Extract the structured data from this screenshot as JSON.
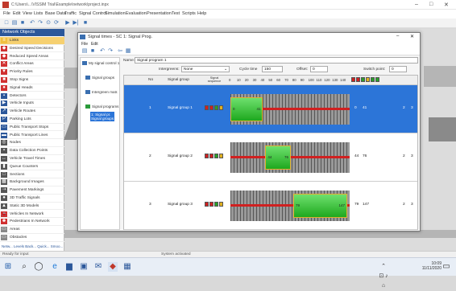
{
  "app": {
    "title": "C:\\Users\\...\\VISSIM Trial\\Example\\network\\project.inpx",
    "window_controls": [
      "–",
      "□",
      "✕"
    ]
  },
  "menu": [
    "File",
    "Edit",
    "View",
    "Lists",
    "Base Data",
    "Traffic",
    "Signal Control",
    "Simulation",
    "Evaluation",
    "Presentation",
    "Test",
    "Scripts",
    "Help"
  ],
  "network_objects": {
    "title": "Network Objects",
    "items": [
      {
        "label": "Links",
        "icon": "≡",
        "color": "#f0c040",
        "selected": true
      },
      {
        "label": "Desired Speed Decisions",
        "icon": "◆",
        "color": "#d03030"
      },
      {
        "label": "Reduced Speed Areas",
        "icon": "◆",
        "color": "#d03030"
      },
      {
        "label": "Conflict Areas",
        "icon": "✕",
        "color": "#d03030"
      },
      {
        "label": "Priority Rules",
        "icon": "▼",
        "color": "#d03030"
      },
      {
        "label": "Stop Signs",
        "icon": "■",
        "color": "#d03030"
      },
      {
        "label": "Signal Heads",
        "icon": "●",
        "color": "#d03030"
      },
      {
        "label": "Detectors",
        "icon": "▪",
        "color": "#2b579a"
      },
      {
        "label": "Vehicle Inputs",
        "icon": "▶",
        "color": "#2b579a"
      },
      {
        "label": "Vehicle Routes",
        "icon": "↗",
        "color": "#2b579a"
      },
      {
        "label": "Parking Lots",
        "icon": "P",
        "color": "#2b579a"
      },
      {
        "label": "Public Transport Stops",
        "icon": "▭",
        "color": "#2b579a"
      },
      {
        "label": "Public Transport Lines",
        "icon": "▬",
        "color": "#2b579a"
      },
      {
        "label": "Nodes",
        "icon": "◎",
        "color": "#555555"
      },
      {
        "label": "Data Collection Points",
        "icon": "▪",
        "color": "#555555"
      },
      {
        "label": "Vehicle Travel Times",
        "icon": "↔",
        "color": "#555555"
      },
      {
        "label": "Queue Counters",
        "icon": "▮",
        "color": "#555555"
      },
      {
        "label": "Sections",
        "icon": "□",
        "color": "#555555"
      },
      {
        "label": "Background Images",
        "icon": "▦",
        "color": "#555555"
      },
      {
        "label": "Pavement Markings",
        "icon": "⇢",
        "color": "#555555"
      },
      {
        "label": "3D Traffic Signals",
        "icon": "●",
        "color": "#555555"
      },
      {
        "label": "Static 3D Models",
        "icon": "▲",
        "color": "#555555"
      },
      {
        "label": "Vehicles In Network",
        "icon": "🚗",
        "color": "#d03030"
      },
      {
        "label": "Pedestrians In Network",
        "icon": "☻",
        "color": "#d03030"
      },
      {
        "label": "Areas",
        "icon": "▭",
        "color": "#888888"
      },
      {
        "label": "Obstacles",
        "icon": "▭",
        "color": "#888888"
      }
    ],
    "tabs": "Netw...  Levels  Back...  Quick...  Smoo..."
  },
  "dialog": {
    "title": "Signal times - SC 1: Signal Prog.",
    "menu": [
      "File",
      "Edit"
    ],
    "tree": {
      "root": "My signal control 1",
      "signal_groups": "Signal groups",
      "intergreen": "Intergreen matr.",
      "programs": "Signal programs",
      "program_item": "1: Signal pr.",
      "group_item": "Signal groups"
    },
    "name_label": "Name:",
    "name_value": "Signal program 1",
    "intergreens_label": "Intergreens:",
    "intergreens_value": "None",
    "cycle_label": "Cycle time",
    "cycle_value": "150",
    "offset_label": "Offset:",
    "offset_value": "0",
    "switch_label": "Switch point:",
    "switch_value": "0",
    "columns": {
      "no": "No",
      "group": "Signal group",
      "seq": "Signal sequence"
    },
    "ticks": [
      "0",
      "10",
      "20",
      "30",
      "40",
      "50",
      "60",
      "70",
      "80",
      "90",
      "100",
      "110",
      "120",
      "130",
      "140"
    ],
    "rows": [
      {
        "no": "1",
        "group": "Signal group 1",
        "start": "0",
        "end": "41",
        "end2": "",
        "a": "2",
        "b": "3",
        "green_from": 0,
        "green_to": 41,
        "selected": true
      },
      {
        "no": "2",
        "group": "Signal group 2",
        "start": "44",
        "end": "76",
        "end2": "",
        "a": "2",
        "b": "3",
        "green_from": 44,
        "green_to": 76,
        "selected": false
      },
      {
        "no": "3",
        "group": "Signal group 3",
        "start": "79",
        "end": "147",
        "end2": "",
        "a": "2",
        "b": "3",
        "green_from": 79,
        "green_to": 147,
        "selected": false
      }
    ]
  },
  "statusbar": {
    "left": "Ready for input",
    "center": "System activated"
  },
  "taskbar": {
    "time": "10:09",
    "date": "11/11/2020"
  }
}
